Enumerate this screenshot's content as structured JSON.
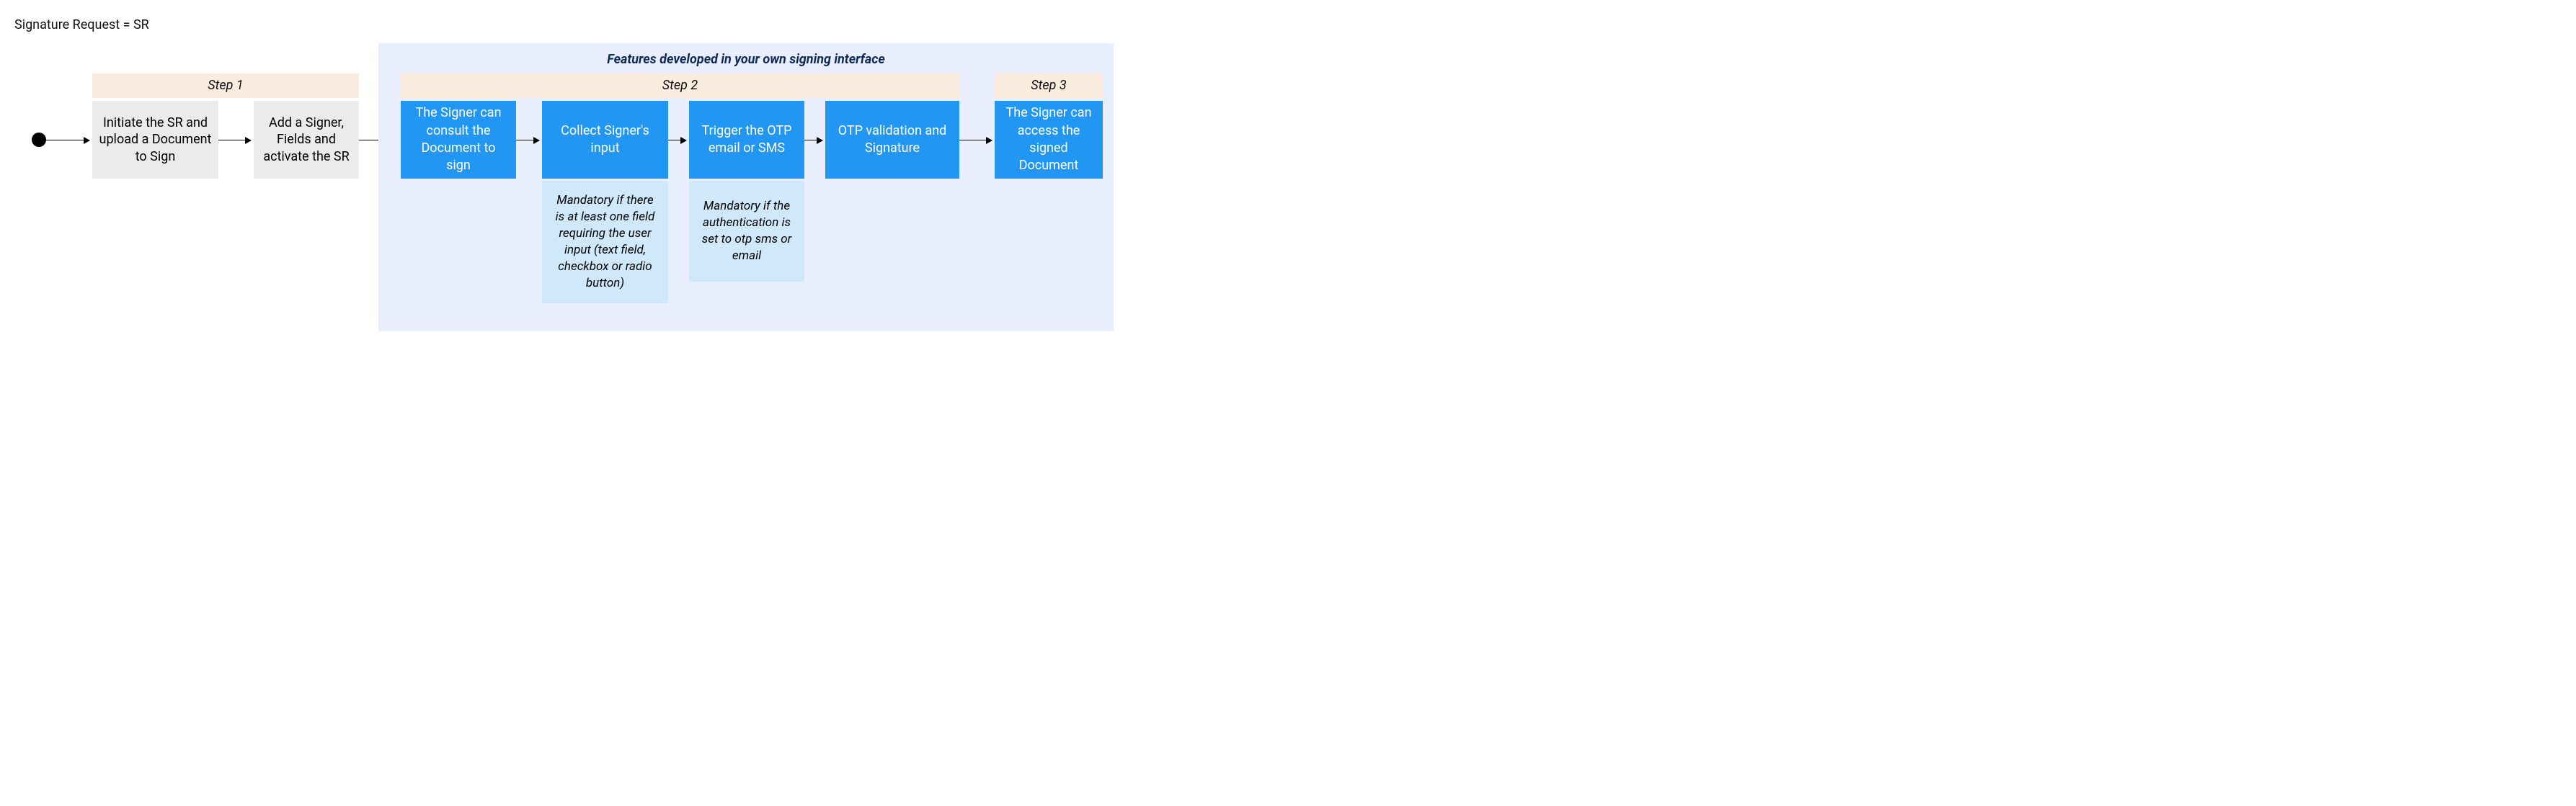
{
  "legend": "Signature Request = SR",
  "feature_title": "Features developed in your own signing interface",
  "steps": {
    "step1": "Step 1",
    "step2": "Step 2",
    "step3": "Step 3"
  },
  "boxes": {
    "step1a": "Initiate the SR and upload a Document to Sign",
    "step1b": "Add a Signer, Fields and activate the SR",
    "step2a": "The Signer can consult the Document to sign",
    "step2b": "Collect Signer's input",
    "step2c": "Trigger the OTP email or SMS",
    "step2d": "OTP validation and Signature",
    "step3a": "The Signer can access the signed Document"
  },
  "notes": {
    "note_b": "Mandatory if there is at least one field requiring the user input (text field, checkbox or radio button)",
    "note_c": "Mandatory if the authentication is set to otp sms or email"
  }
}
